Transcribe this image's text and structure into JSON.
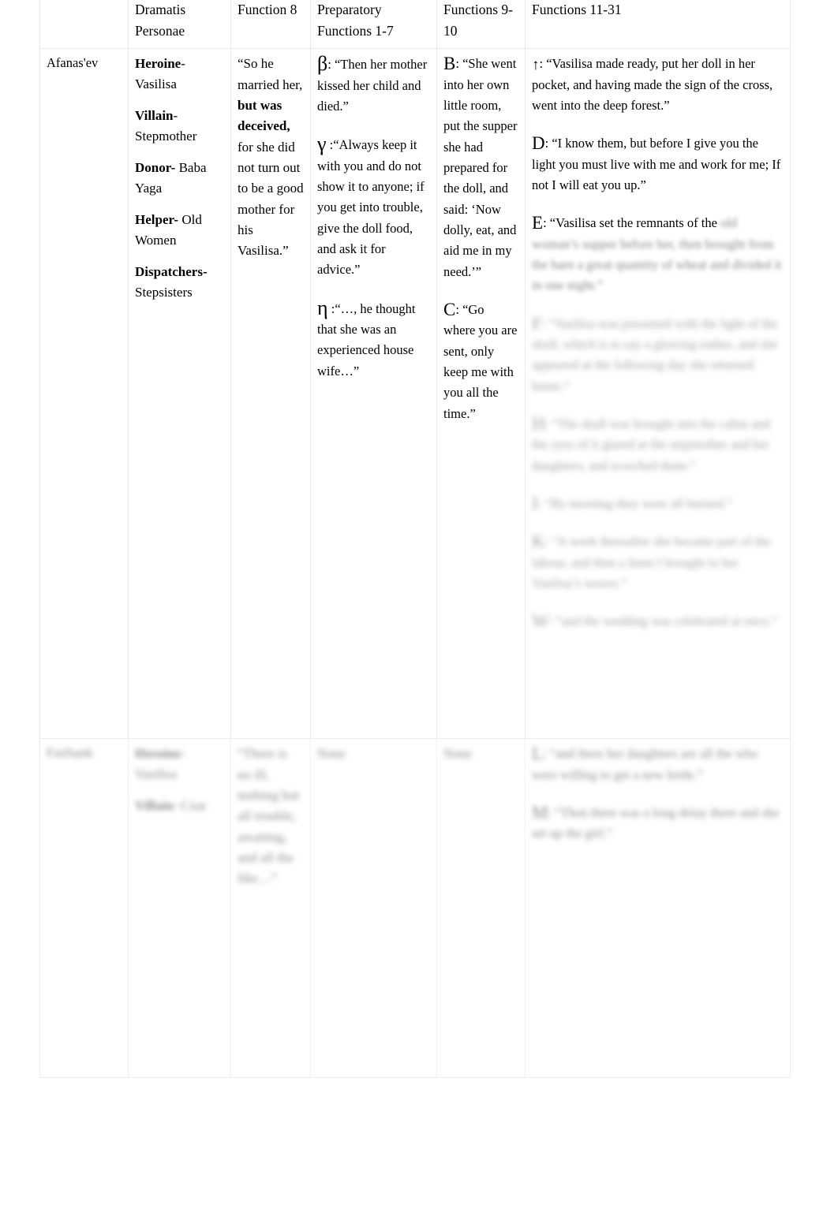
{
  "document": {
    "type": "table",
    "title": "Propp Morphology Comparison Table"
  },
  "table": {
    "headers": [
      {
        "id": "source",
        "label": ""
      },
      {
        "id": "personae",
        "label": "Dramatis Personae"
      },
      {
        "id": "function8",
        "label": "Function 8"
      },
      {
        "id": "prep",
        "label": "Preparatory Functions 1-7"
      },
      {
        "id": "f910",
        "label": "Functions 9-10"
      },
      {
        "id": "f1131",
        "label": "Functions 11-31"
      }
    ],
    "rows": [
      {
        "source": "Afanas'ev",
        "personae": [
          {
            "role": "Heroine",
            "sep": "-",
            "name": "Vasilisa"
          },
          {
            "role": "Villain",
            "sep": "-",
            "name": "Stepmother"
          },
          {
            "role": "Donor-",
            "sep": "",
            "name": "Baba Yaga"
          },
          {
            "role": "Helper-",
            "sep": "",
            "name": "Old Women"
          },
          {
            "role": "Dispatchers-",
            "sep": "",
            "name": "Stepsisters"
          }
        ],
        "function8": {
          "pre": "“So he married her, ",
          "bold": "but was deceived,",
          "post": " for she did not turn out to be a good mother for his Vasilisa.”"
        },
        "prep": [
          {
            "symbol": "β",
            "sep": ": ",
            "text": "“Then her mother kissed her child and died.”"
          },
          {
            "symbol": "γ",
            "sep": " :",
            "text": "“Always keep it with you and do not show it to anyone; if you get into trouble, give the doll food, and ask it for advice.”"
          },
          {
            "symbol": "η",
            "sep": " :",
            "text": "“…, he thought that she was an experienced house wife…”"
          }
        ],
        "f910": [
          {
            "symbol": "B",
            "sep": ": ",
            "text": "“She went into her own little room, put the supper she had prepared for the doll, and said: ‘Now dolly, eat, and aid me in my need.’”"
          },
          {
            "symbol": "C",
            "sep": ": ",
            "text": "“Go where you are sent, only keep me with you all the time.”"
          }
        ],
        "f1131": [
          {
            "symbol": "↑",
            "sep": ": ",
            "text": "“Vasilisa made ready, put her doll in her pocket, and having made the sign of the cross, went into the deep forest.”",
            "blurred": false
          },
          {
            "symbol": "D",
            "sep": ": ",
            "text": "“I know them, but before I give you the light you must live with me and work for me; If not I will eat you up.”",
            "blurred": false
          },
          {
            "symbol": "E",
            "sep": ": ",
            "text": "“Vasilisa set the remnants of the",
            "tail": " old woman’s supper before her, then brought from the barn a great quantity of wheat and divided it in one night.”",
            "blurred": "tail"
          },
          {
            "symbol": "F",
            "sep": ": ",
            "text": "“Vasilisa was presented with the light of the skull, which is to say a glowing ember, and she appeared at the following day she returned home.”",
            "blurred": "all"
          },
          {
            "symbol": "H",
            "sep": ": ",
            "text": "“The skull was brought into the cabin and the eyes of it glared at the stepmother and her daughters, and scorched them.”",
            "blurred": "all"
          },
          {
            "symbol": "I",
            "sep": ": ",
            "text": "“By morning they were all burned.”",
            "blurred": "all"
          },
          {
            "symbol": "K",
            "sep": ": ",
            "text": "“A week thereafter she became part of the labour, and then a linen I brought to her Vasilisa’s weave.”",
            "blurred": "all"
          },
          {
            "symbol": "W",
            "sep": ": ",
            "text": "“and the wedding was celebrated at once.”",
            "blurred": "all"
          }
        ]
      },
      {
        "source": "Fairbank",
        "personae": [
          {
            "role": "Heroine",
            "sep": "-",
            "name": "Vasilisa"
          },
          {
            "role": "Villain",
            "sep": "-",
            "name": "Czar"
          }
        ],
        "function8": {
          "pre": "“There is no ill, nothing but all trouble, awaiting, and all the like…”",
          "bold": "",
          "post": ""
        },
        "prep": [
          {
            "symbol": "",
            "sep": "",
            "text": "None"
          }
        ],
        "f910": [
          {
            "symbol": "",
            "sep": "",
            "text": "None"
          }
        ],
        "f1131": [
          {
            "symbol": "L",
            "sep": ": ",
            "text": "“and there her daughters are all the who were willing to get a new bride.”",
            "blurred": "all"
          },
          {
            "symbol": "M",
            "sep": ": ",
            "text": "“Then there was a long delay there and she set up the girl.”",
            "blurred": "all"
          }
        ],
        "blurred": true
      }
    ]
  }
}
